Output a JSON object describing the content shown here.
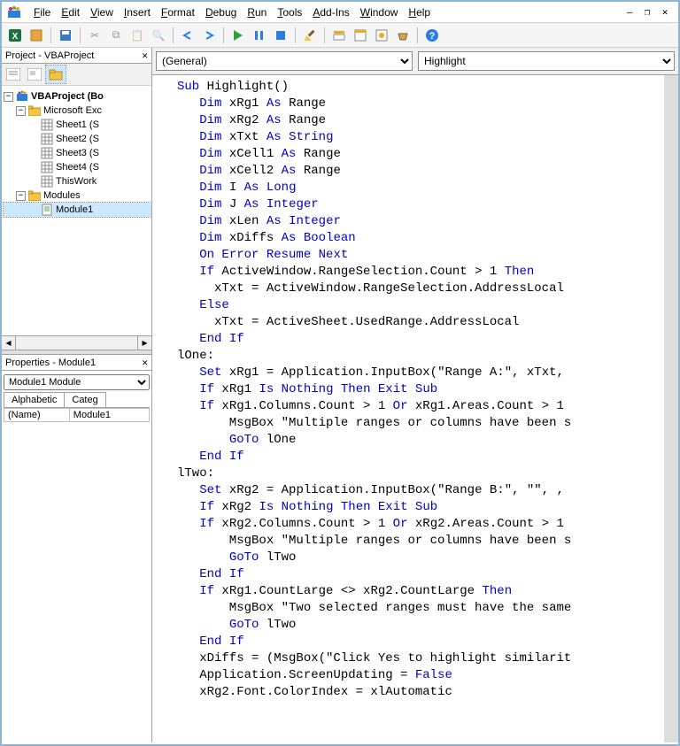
{
  "menu": {
    "items": [
      "File",
      "Edit",
      "View",
      "Insert",
      "Format",
      "Debug",
      "Run",
      "Tools",
      "Add-Ins",
      "Window",
      "Help"
    ]
  },
  "project_pane": {
    "title": "Project - VBAProject",
    "root": "VBAProject (Bo",
    "excel_folder": "Microsoft Exc",
    "sheets": [
      "Sheet1 (S",
      "Sheet2 (S",
      "Sheet3 (S",
      "Sheet4 (S",
      "ThisWork"
    ],
    "modules_folder": "Modules",
    "module1": "Module1"
  },
  "properties_pane": {
    "title": "Properties - Module1",
    "object": "Module1 Module",
    "tabs": [
      "Alphabetic",
      "Categ"
    ],
    "name_label": "(Name)",
    "name_value": "Module1"
  },
  "code": {
    "dropdown_left": "(General)",
    "dropdown_right": "Highlight",
    "lines": [
      [
        [
          "kw",
          "Sub"
        ],
        [
          "",
          " Highlight()"
        ]
      ],
      [
        [
          "",
          "   "
        ],
        [
          "kw",
          "Dim"
        ],
        [
          "",
          " xRg1 "
        ],
        [
          "kw",
          "As"
        ],
        [
          "",
          " Range"
        ]
      ],
      [
        [
          "",
          "   "
        ],
        [
          "kw",
          "Dim"
        ],
        [
          "",
          " xRg2 "
        ],
        [
          "kw",
          "As"
        ],
        [
          "",
          " Range"
        ]
      ],
      [
        [
          "",
          "   "
        ],
        [
          "kw",
          "Dim"
        ],
        [
          "",
          " xTxt "
        ],
        [
          "kw",
          "As"
        ],
        [
          "",
          " "
        ],
        [
          "kw",
          "String"
        ]
      ],
      [
        [
          "",
          "   "
        ],
        [
          "kw",
          "Dim"
        ],
        [
          "",
          " xCell1 "
        ],
        [
          "kw",
          "As"
        ],
        [
          "",
          " Range"
        ]
      ],
      [
        [
          "",
          "   "
        ],
        [
          "kw",
          "Dim"
        ],
        [
          "",
          " xCell2 "
        ],
        [
          "kw",
          "As"
        ],
        [
          "",
          " Range"
        ]
      ],
      [
        [
          "",
          "   "
        ],
        [
          "kw",
          "Dim"
        ],
        [
          "",
          " I "
        ],
        [
          "kw",
          "As"
        ],
        [
          "",
          " "
        ],
        [
          "kw",
          "Long"
        ]
      ],
      [
        [
          "",
          "   "
        ],
        [
          "kw",
          "Dim"
        ],
        [
          "",
          " J "
        ],
        [
          "kw",
          "As"
        ],
        [
          "",
          " "
        ],
        [
          "kw",
          "Integer"
        ]
      ],
      [
        [
          "",
          "   "
        ],
        [
          "kw",
          "Dim"
        ],
        [
          "",
          " xLen "
        ],
        [
          "kw",
          "As"
        ],
        [
          "",
          " "
        ],
        [
          "kw",
          "Integer"
        ]
      ],
      [
        [
          "",
          "   "
        ],
        [
          "kw",
          "Dim"
        ],
        [
          "",
          " xDiffs "
        ],
        [
          "kw",
          "As"
        ],
        [
          "",
          " "
        ],
        [
          "kw",
          "Boolean"
        ]
      ],
      [
        [
          "",
          "   "
        ],
        [
          "kw",
          "On Error Resume Next"
        ]
      ],
      [
        [
          "",
          "   "
        ],
        [
          "kw",
          "If"
        ],
        [
          "",
          " ActiveWindow.RangeSelection.Count > 1 "
        ],
        [
          "kw",
          "Then"
        ]
      ],
      [
        [
          "",
          "     xTxt = ActiveWindow.RangeSelection.AddressLocal"
        ]
      ],
      [
        [
          "",
          "   "
        ],
        [
          "kw",
          "Else"
        ]
      ],
      [
        [
          "",
          "     xTxt = ActiveSheet.UsedRange.AddressLocal"
        ]
      ],
      [
        [
          "",
          "   "
        ],
        [
          "kw",
          "End If"
        ]
      ],
      [
        [
          "",
          "lOne:"
        ]
      ],
      [
        [
          "",
          "   "
        ],
        [
          "kw",
          "Set"
        ],
        [
          "",
          " xRg1 = Application.InputBox(\"Range A:\", xTxt, "
        ]
      ],
      [
        [
          "",
          "   "
        ],
        [
          "kw",
          "If"
        ],
        [
          "",
          " xRg1 "
        ],
        [
          "kw",
          "Is"
        ],
        [
          "",
          " "
        ],
        [
          "kw",
          "Nothing"
        ],
        [
          "",
          " "
        ],
        [
          "kw",
          "Then"
        ],
        [
          "",
          " "
        ],
        [
          "kw",
          "Exit Sub"
        ]
      ],
      [
        [
          "",
          "   "
        ],
        [
          "kw",
          "If"
        ],
        [
          "",
          " xRg1.Columns.Count > 1 "
        ],
        [
          "kw",
          "Or"
        ],
        [
          "",
          " xRg1.Areas.Count > 1 "
        ]
      ],
      [
        [
          "",
          "       MsgBox \"Multiple ranges or columns have been s"
        ]
      ],
      [
        [
          "",
          "       "
        ],
        [
          "kw",
          "GoTo"
        ],
        [
          "",
          " lOne"
        ]
      ],
      [
        [
          "",
          "   "
        ],
        [
          "kw",
          "End If"
        ]
      ],
      [
        [
          "",
          "lTwo:"
        ]
      ],
      [
        [
          "",
          "   "
        ],
        [
          "kw",
          "Set"
        ],
        [
          "",
          " xRg2 = Application.InputBox(\"Range B:\", \"\", ,"
        ]
      ],
      [
        [
          "",
          "   "
        ],
        [
          "kw",
          "If"
        ],
        [
          "",
          " xRg2 "
        ],
        [
          "kw",
          "Is"
        ],
        [
          "",
          " "
        ],
        [
          "kw",
          "Nothing"
        ],
        [
          "",
          " "
        ],
        [
          "kw",
          "Then"
        ],
        [
          "",
          " "
        ],
        [
          "kw",
          "Exit Sub"
        ]
      ],
      [
        [
          "",
          "   "
        ],
        [
          "kw",
          "If"
        ],
        [
          "",
          " xRg2.Columns.Count > 1 "
        ],
        [
          "kw",
          "Or"
        ],
        [
          "",
          " xRg2.Areas.Count > 1 "
        ]
      ],
      [
        [
          "",
          "       MsgBox \"Multiple ranges or columns have been s"
        ]
      ],
      [
        [
          "",
          "       "
        ],
        [
          "kw",
          "GoTo"
        ],
        [
          "",
          " lTwo"
        ]
      ],
      [
        [
          "",
          "   "
        ],
        [
          "kw",
          "End If"
        ]
      ],
      [
        [
          "",
          "   "
        ],
        [
          "kw",
          "If"
        ],
        [
          "",
          " xRg1.CountLarge <> xRg2.CountLarge "
        ],
        [
          "kw",
          "Then"
        ]
      ],
      [
        [
          "",
          "       MsgBox \"Two selected ranges must have the same"
        ]
      ],
      [
        [
          "",
          "       "
        ],
        [
          "kw",
          "GoTo"
        ],
        [
          "",
          " lTwo"
        ]
      ],
      [
        [
          "",
          "   "
        ],
        [
          "kw",
          "End If"
        ]
      ],
      [
        [
          "",
          "   xDiffs = (MsgBox(\"Click Yes to highlight similarit"
        ]
      ],
      [
        [
          "",
          "   Application.ScreenUpdating = "
        ],
        [
          "kw",
          "False"
        ]
      ],
      [
        [
          "",
          "   xRg2.Font.ColorIndex = xlAutomatic"
        ]
      ]
    ]
  }
}
